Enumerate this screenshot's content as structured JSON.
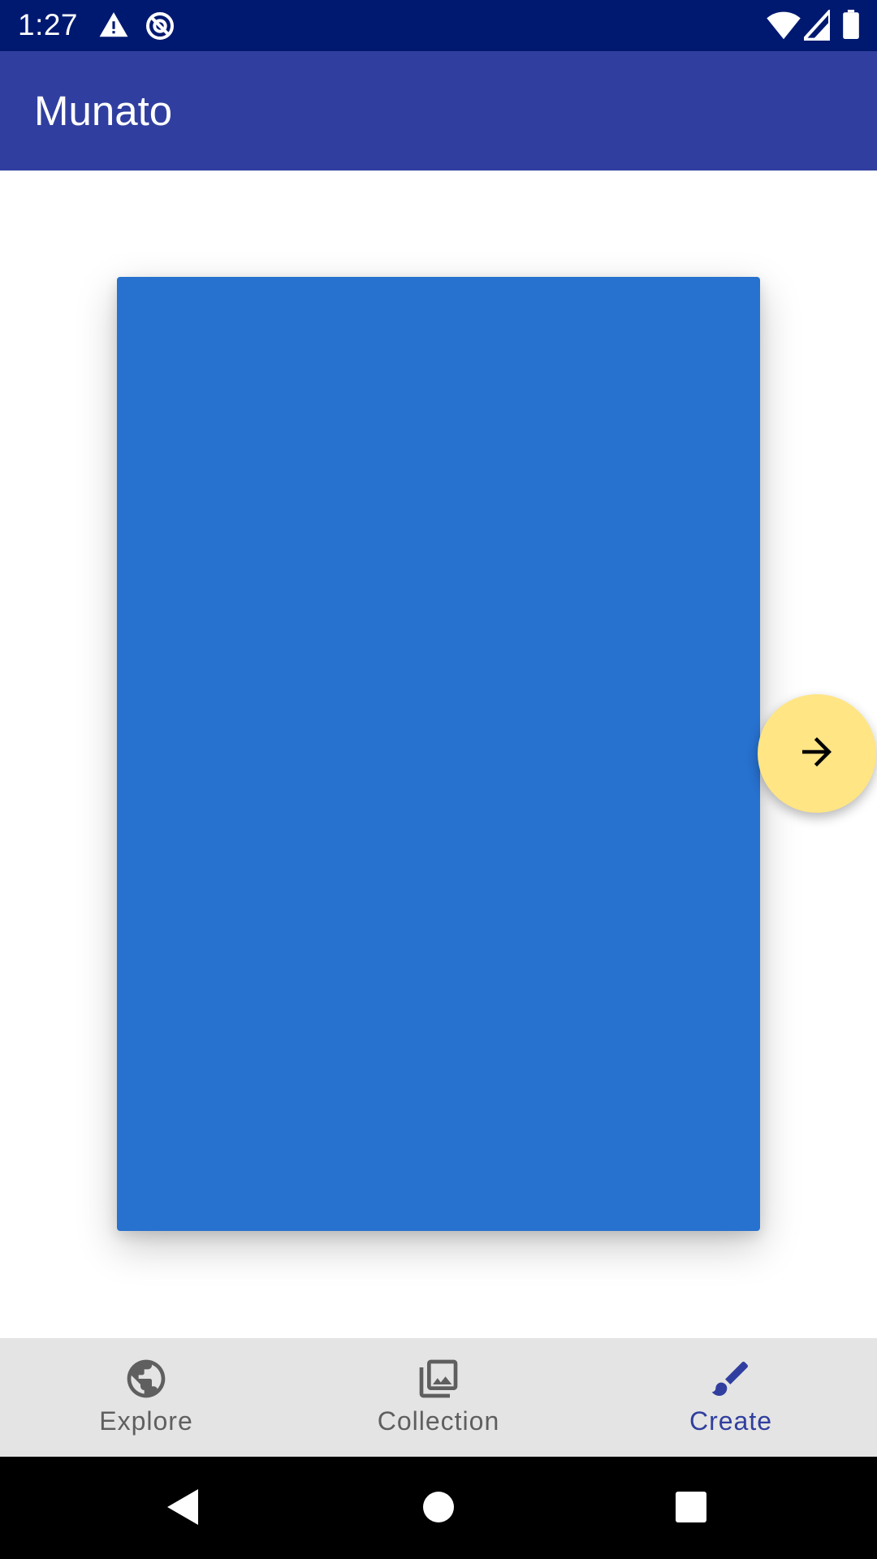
{
  "status_bar": {
    "time": "1:27",
    "icons_left": [
      "warning-icon",
      "sync-disabled-icon"
    ],
    "icons_right": [
      "wifi-icon",
      "cellular-signal-icon",
      "battery-icon"
    ]
  },
  "app_bar": {
    "title": "Munato"
  },
  "canvas": {
    "color": "#2771cf"
  },
  "fab": {
    "icon": "arrow-forward-icon",
    "color": "#ffe584"
  },
  "bottom_nav": {
    "items": [
      {
        "label": "Explore",
        "icon": "globe-icon",
        "active": false
      },
      {
        "label": "Collection",
        "icon": "photo-library-icon",
        "active": false
      },
      {
        "label": "Create",
        "icon": "brush-icon",
        "active": true
      }
    ],
    "active_color": "#303f9f",
    "inactive_color": "#5f5f5f"
  },
  "system_nav": {
    "buttons": [
      "back-icon",
      "home-icon",
      "recents-icon"
    ]
  }
}
